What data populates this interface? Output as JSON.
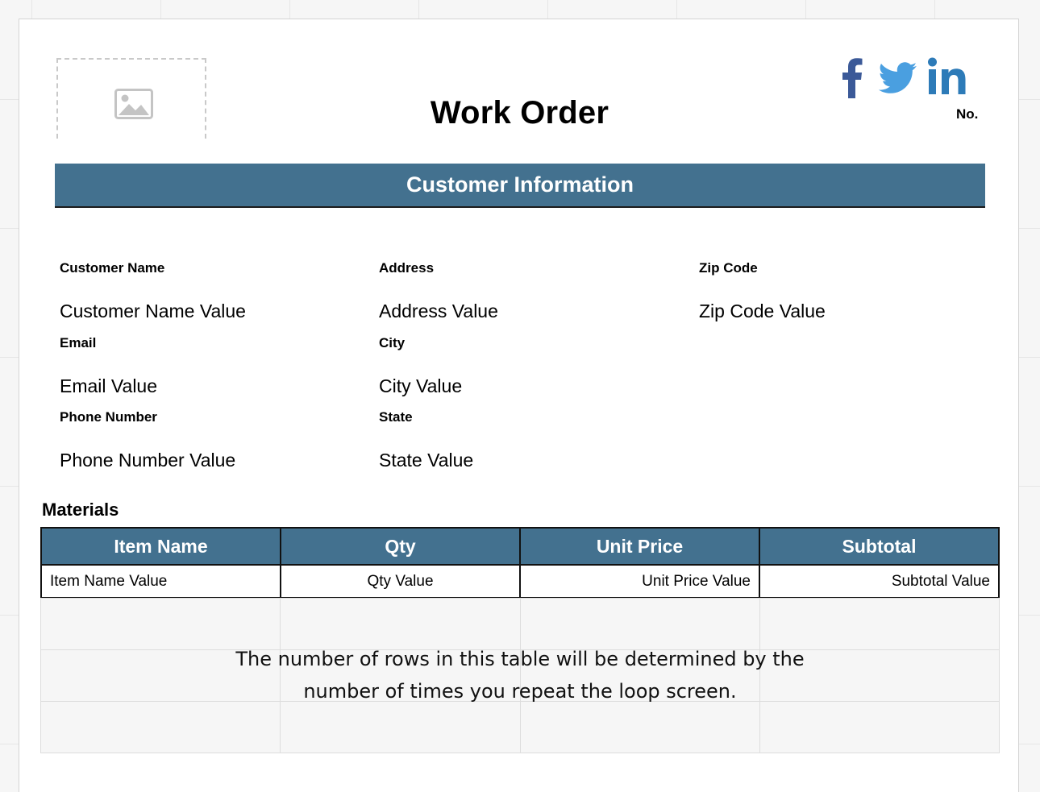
{
  "header": {
    "title": "Work Order",
    "number_label": "No.",
    "social_icons": [
      "facebook-icon",
      "twitter-icon",
      "linkedin-icon"
    ],
    "colors": {
      "facebook": "#3b5998",
      "twitter": "#4a9fe0",
      "linkedin": "#2d7bb8"
    }
  },
  "customer_section": {
    "title": "Customer Information",
    "bar_color": "#43718f",
    "fields": [
      {
        "label": "Customer Name",
        "value": "Customer Name Value"
      },
      {
        "label": "Address",
        "value": "Address Value"
      },
      {
        "label": "Zip Code",
        "value": "Zip Code Value"
      },
      {
        "label": "Email",
        "value": "Email Value"
      },
      {
        "label": "City",
        "value": "City Value"
      },
      {
        "label": "Phone Number",
        "value": "Phone Number Value"
      },
      {
        "label": "State",
        "value": "State Value"
      }
    ]
  },
  "materials": {
    "title": "Materials",
    "columns": [
      "Item Name",
      "Qty",
      "Unit Price",
      "Subtotal"
    ],
    "rows": [
      [
        "Item Name Value",
        "Qty Value",
        "Unit Price Value",
        "Subtotal Value"
      ]
    ],
    "loop_note_line1": "The number of rows in this table will be determined by the",
    "loop_note_line2": "number of times you repeat the loop screen."
  }
}
